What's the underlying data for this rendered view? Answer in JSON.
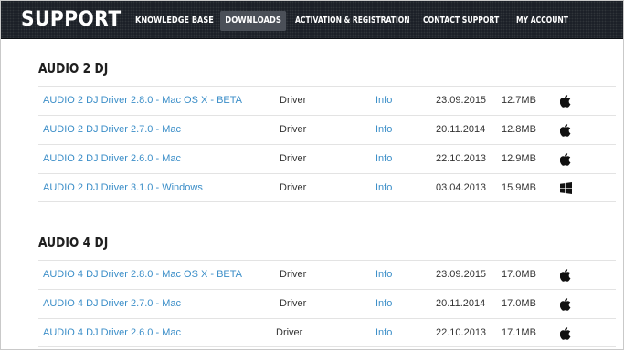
{
  "header": {
    "logo": "SUPPORT",
    "nav": [
      {
        "label": "KNOWLEDGE BASE",
        "active": false
      },
      {
        "label": "DOWNLOADS",
        "active": true
      },
      {
        "label": "ACTIVATION & REGISTRATION",
        "active": false
      },
      {
        "label": "CONTACT SUPPORT",
        "active": false
      },
      {
        "label": "MY ACCOUNT",
        "active": false
      }
    ]
  },
  "colors": {
    "header_bg": "#1b2027",
    "link": "#3b8ec8",
    "text": "#333333",
    "active_nav_bg": "#4b5058"
  },
  "sections": [
    {
      "title": "AUDIO 2 DJ",
      "rows": [
        {
          "name": "AUDIO 2 DJ Driver 2.8.0 - Mac OS X - BETA",
          "type": "Driver",
          "info": "Info",
          "date": "23.09.2015",
          "size": "12.7MB",
          "os": "apple-icon"
        },
        {
          "name": "AUDIO 2 DJ Driver 2.7.0 - Mac",
          "type": "Driver",
          "info": "Info",
          "date": "20.11.2014",
          "size": "12.8MB",
          "os": "apple-icon"
        },
        {
          "name": "AUDIO 2 DJ Driver 2.6.0 - Mac",
          "type": "Driver",
          "info": "Info",
          "date": "22.10.2013",
          "size": "12.9MB",
          "os": "apple-icon"
        },
        {
          "name": "AUDIO 2 DJ Driver 3.1.0 - Windows",
          "type": "Driver",
          "info": "Info",
          "date": "03.04.2013",
          "size": "15.9MB",
          "os": "windows-icon"
        }
      ]
    },
    {
      "title": "AUDIO 4 DJ",
      "rows": [
        {
          "name": "AUDIO 4 DJ Driver 2.8.0 - Mac OS X - BETA",
          "type": "Driver",
          "info": "Info",
          "date": "23.09.2015",
          "size": "17.0MB",
          "os": "apple-icon"
        },
        {
          "name": "AUDIO 4 DJ Driver 2.7.0 - Mac",
          "type": "Driver",
          "info": "Info",
          "date": "20.11.2014",
          "size": "17.0MB",
          "os": "apple-icon"
        },
        {
          "name": "AUDIO 4 DJ Driver 2.6.0 - Mac",
          "type": "Driver",
          "info": "Info",
          "date": "22.10.2013",
          "size": "17.1MB",
          "os": "apple-icon"
        }
      ]
    }
  ]
}
